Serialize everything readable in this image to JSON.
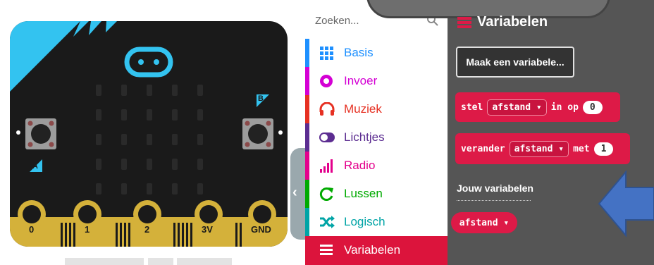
{
  "simulator": {
    "pins": [
      "0",
      "1",
      "2",
      "3V",
      "GND"
    ],
    "button_a_label": "A",
    "button_b_label": "B"
  },
  "toolbox": {
    "search_placeholder": "Zoeken...",
    "categories": [
      {
        "label": "Basis",
        "color": "#1e90ff",
        "icon": "grid-icon"
      },
      {
        "label": "Invoer",
        "color": "#d400d4",
        "icon": "circle-dot-icon"
      },
      {
        "label": "Muziek",
        "color": "#e63022",
        "icon": "headphones-icon"
      },
      {
        "label": "Lichtjes",
        "color": "#5c2d91",
        "icon": "toggle-icon"
      },
      {
        "label": "Radio",
        "color": "#e3008c",
        "icon": "signal-bars-icon"
      },
      {
        "label": "Lussen",
        "color": "#00aa00",
        "icon": "refresh-icon"
      },
      {
        "label": "Logisch",
        "color": "#00a4a6",
        "icon": "shuffle-icon"
      },
      {
        "label": "Variabelen",
        "color": "#dc143c",
        "icon": "list-icon"
      }
    ]
  },
  "flyout": {
    "title": "Variabelen",
    "make_variable_button": "Maak een variabele...",
    "set_block": {
      "prefix": "stel",
      "variable": "afstand",
      "suffix": "in op",
      "value": "0"
    },
    "change_block": {
      "prefix": "verander",
      "variable": "afstand",
      "suffix": "met",
      "value": "1"
    },
    "your_variables_label": "Jouw variabelen",
    "variable_pill": "afstand"
  },
  "colors": {
    "variables_red": "#dd1a47",
    "flyout_bg": "#555555",
    "board_bg": "#1a1a1a",
    "board_accent": "#33c3f0",
    "pin_gold": "#d4b13a"
  }
}
